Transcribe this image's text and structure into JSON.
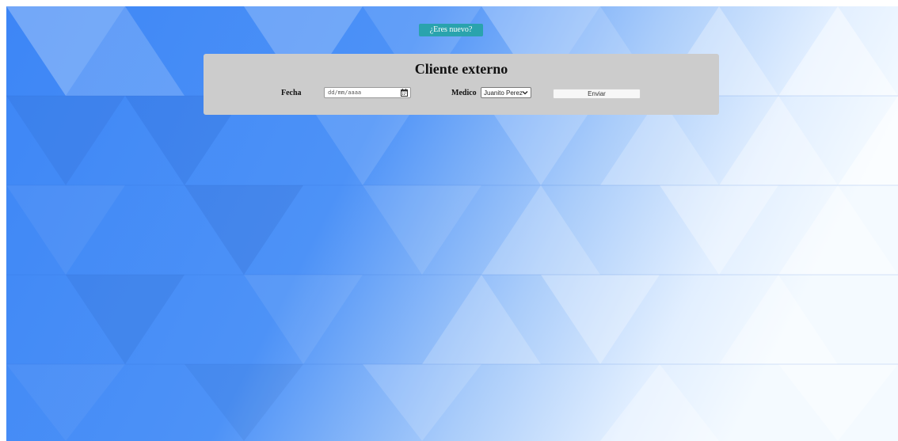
{
  "header": {
    "new_user_link": "¿Eres nuevo?"
  },
  "form": {
    "title": "Cliente externo",
    "date_label": "Fecha",
    "date_placeholder": "dd/mm/aaaa",
    "doctor_label": "Medico",
    "doctor_selected": "Juanito Perez",
    "submit_label": "Enviar"
  },
  "colors": {
    "new_button": "#2aa3ad",
    "card_background": "#cccccc",
    "background_blue": "#3f88f7"
  },
  "icons": {
    "date_picker": "calendar-icon",
    "doctor_dropdown": "chevron-down-icon"
  }
}
